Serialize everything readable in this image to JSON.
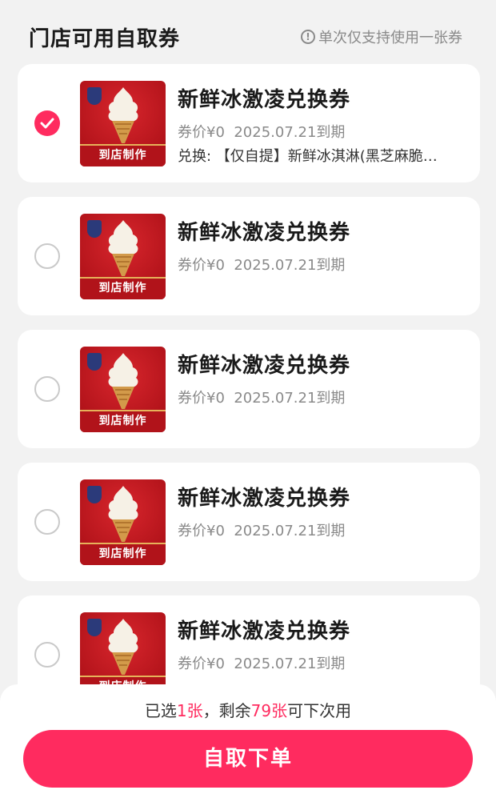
{
  "header": {
    "title": "门店可用自取券",
    "notice": "单次仅支持使用一张券",
    "notice_icon": "info-icon"
  },
  "coupons": [
    {
      "name": "新鲜冰激凌兑换券",
      "price_label": "券价¥0",
      "expiry": "2025.07.21到期",
      "description": "兑换: 【仅自提】新鲜冰淇淋(黑芝麻脆…",
      "image_label": "到店制作",
      "selected": true
    },
    {
      "name": "新鲜冰激凌兑换券",
      "price_label": "券价¥0",
      "expiry": "2025.07.21到期",
      "image_label": "到店制作",
      "selected": false
    },
    {
      "name": "新鲜冰激凌兑换券",
      "price_label": "券价¥0",
      "expiry": "2025.07.21到期",
      "image_label": "到店制作",
      "selected": false
    },
    {
      "name": "新鲜冰激凌兑换券",
      "price_label": "券价¥0",
      "expiry": "2025.07.21到期",
      "image_label": "到店制作",
      "selected": false
    },
    {
      "name": "新鲜冰激凌兑换券",
      "price_label": "券价¥0",
      "expiry": "2025.07.21到期",
      "image_label": "到店制作",
      "selected": false
    }
  ],
  "footer": {
    "summary_prefix": "已选",
    "selected_count": "1张",
    "summary_mid": "，剩余",
    "remaining_count": "79张",
    "summary_suffix": "可下次用",
    "submit_label": "自取下单"
  },
  "colors": {
    "accent": "#ff2b5f",
    "background": "#f2f2f2",
    "card": "#ffffff",
    "muted_text": "#8a8a8a"
  }
}
